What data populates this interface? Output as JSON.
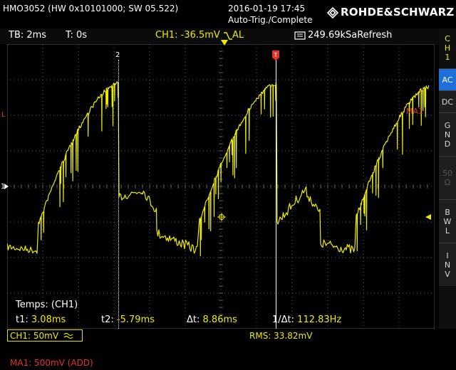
{
  "header": {
    "model": "HMO3052 (HW 0x10101000; SW 05.522)",
    "datetime": "2016-01-19 17:45",
    "trigger_state": "Auto-Trig./Complete",
    "brand": "ROHDE&SCHWARZ"
  },
  "status_bar": {
    "timebase": "TB: 2ms",
    "trigger_time": "T: 0s",
    "trigger_level": "CH1: -36.5mV",
    "trigger_mode": "AL",
    "sample_info": "249.69kSaRefresh"
  },
  "sidebar": {
    "channel": [
      "C",
      "H",
      "1"
    ],
    "buttons": [
      {
        "label": [
          "AC"
        ],
        "active": true
      },
      {
        "label": [
          "DC"
        ],
        "active": false
      },
      {
        "label": [
          "G",
          "N",
          "D"
        ],
        "active": false
      },
      {
        "label": [
          "50",
          "Ω"
        ],
        "active": false,
        "dim": true
      },
      {
        "label": [
          "B",
          "W",
          "L"
        ],
        "active": false
      },
      {
        "label": [
          "I",
          "N",
          "V"
        ],
        "active": false
      }
    ]
  },
  "graticule": {
    "markers": {
      "cursor2": "2",
      "math": "MA1",
      "ch1_level": "1",
      "trigger": "T"
    },
    "measurement_title": "Temps: (CH1)",
    "measurements": [
      {
        "label": "t1:",
        "value": "3.08ms"
      },
      {
        "label": "t2:",
        "value": "-5.79ms"
      },
      {
        "label": "Δt:",
        "value": "8.86ms"
      },
      {
        "label": "1/Δt:",
        "value": "112.83Hz"
      }
    ]
  },
  "bottom": {
    "ch1": "CH1: 50mV",
    "rms": "RMS: 33.82mV",
    "ma1": "MA1: 500mV (ADD)"
  },
  "colors": {
    "trace": "#ecec00",
    "accent_blue": "#1e6fd8",
    "math_red": "#e53030",
    "grid": "#5a5a5a"
  }
}
